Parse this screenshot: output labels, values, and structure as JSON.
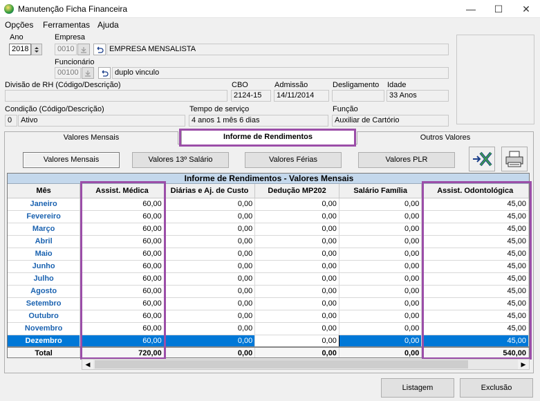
{
  "window": {
    "title": "Manutenção Ficha Financeira",
    "minimize": "—",
    "maximize": "☐",
    "close": "✕"
  },
  "menu": [
    "Opções",
    "Ferramentas",
    "Ajuda"
  ],
  "fields": {
    "ano_label": "Ano",
    "ano_value": "2018",
    "empresa_label": "Empresa",
    "empresa_code": "0010",
    "empresa_name": "EMPRESA MENSALISTA",
    "funcionario_label": "Funcionário",
    "funcionario_code": "00100",
    "funcionario_name": "duplo vinculo",
    "divisao_label": "Divisão de RH (Código/Descrição)",
    "divisao_value": "",
    "cbo_label": "CBO",
    "cbo_value": "2124-15",
    "admissao_label": "Admissão",
    "admissao_value": "14/11/2014",
    "desligamento_label": "Desligamento",
    "desligamento_value": "",
    "idade_label": "Idade",
    "idade_value": "33 Anos",
    "condicao_label": "Condição (Código/Descrição)",
    "condicao_code": "0",
    "condicao_value": "Ativo",
    "tempo_label": "Tempo de serviço",
    "tempo_value": "4 anos 1 mês 6 dias",
    "funcao_label": "Função",
    "funcao_value": "Auxiliar de Cartório"
  },
  "tabs": [
    "Valores Mensais",
    "Informe de Rendimentos",
    "Outros Valores"
  ],
  "active_tab": "Informe de Rendimentos",
  "subbuttons": [
    "Valores Mensais",
    "Valores 13º Salário",
    "Valores Férias",
    "Valores PLR"
  ],
  "grid": {
    "caption": "Informe de Rendimentos - Valores Mensais",
    "columns": [
      "Mês",
      "Assist. Médica",
      "Diárias e Aj. de Custo",
      "Dedução MP202",
      "Salário Família",
      "Assist. Odontológica"
    ],
    "rows": [
      [
        "Janeiro",
        "60,00",
        "0,00",
        "0,00",
        "0,00",
        "45,00"
      ],
      [
        "Fevereiro",
        "60,00",
        "0,00",
        "0,00",
        "0,00",
        "45,00"
      ],
      [
        "Março",
        "60,00",
        "0,00",
        "0,00",
        "0,00",
        "45,00"
      ],
      [
        "Abril",
        "60,00",
        "0,00",
        "0,00",
        "0,00",
        "45,00"
      ],
      [
        "Maio",
        "60,00",
        "0,00",
        "0,00",
        "0,00",
        "45,00"
      ],
      [
        "Junho",
        "60,00",
        "0,00",
        "0,00",
        "0,00",
        "45,00"
      ],
      [
        "Julho",
        "60,00",
        "0,00",
        "0,00",
        "0,00",
        "45,00"
      ],
      [
        "Agosto",
        "60,00",
        "0,00",
        "0,00",
        "0,00",
        "45,00"
      ],
      [
        "Setembro",
        "60,00",
        "0,00",
        "0,00",
        "0,00",
        "45,00"
      ],
      [
        "Outubro",
        "60,00",
        "0,00",
        "0,00",
        "0,00",
        "45,00"
      ],
      [
        "Novembro",
        "60,00",
        "0,00",
        "0,00",
        "0,00",
        "45,00"
      ],
      [
        "Dezembro",
        "60,00",
        "0,00",
        "0,00",
        "0,00",
        "45,00"
      ]
    ],
    "selected_row": 11,
    "total": [
      "Total",
      "720,00",
      "0,00",
      "0,00",
      "0,00",
      "540,00"
    ]
  },
  "footer": {
    "listagem": "Listagem",
    "exclusao": "Exclusão"
  },
  "colors": {
    "highlight": "#9b4ea8",
    "selection": "#0078d7",
    "month_text": "#1a62b0",
    "caption_bg": "#c4d8ec"
  },
  "icons": {
    "export": "excel-export-icon",
    "print": "printer-icon"
  }
}
